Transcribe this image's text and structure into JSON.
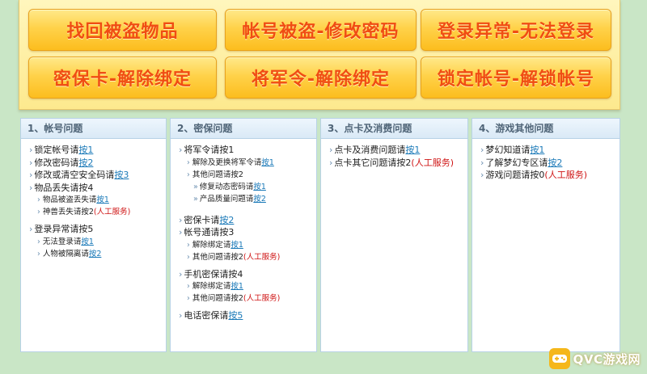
{
  "top_buttons": [
    {
      "label": "找回被盗物品"
    },
    {
      "label": "帐号被盗-修改密码"
    },
    {
      "label": "登录异常-无法登录"
    },
    {
      "label": "密保卡-解除绑定"
    },
    {
      "label": "将军令-解除绑定"
    },
    {
      "label": "锁定帐号-解锁帐号"
    }
  ],
  "panel1": {
    "title": "1、帐号问题",
    "items": [
      {
        "text": "锁定帐号请",
        "link": "按1"
      },
      {
        "text": "修改密码请",
        "link": "按2"
      },
      {
        "text": "修改或清空安全码请",
        "link": "按3"
      },
      {
        "text": "物品丢失请按4"
      },
      {
        "text": "物品被盗丢失请",
        "link": "按1"
      },
      {
        "text": "神兽丢失请按2",
        "tag": "(人工服务)"
      },
      {
        "text": "登录异常请按5"
      },
      {
        "text": "无法登录请",
        "link": "按1"
      },
      {
        "text": "人物被隔离请",
        "link": "按2"
      }
    ]
  },
  "panel2": {
    "title": "2、密保问题",
    "items": [
      {
        "text": "将军令请按1"
      },
      {
        "text": "解除及更换将军令请",
        "link": "按1"
      },
      {
        "text": "其他问题请按2"
      },
      {
        "text": "修复动态密码请",
        "link": "按1"
      },
      {
        "text": "产品质量问题请",
        "link": "按2"
      },
      {
        "text": "密保卡请",
        "link": "按2"
      },
      {
        "text": "帐号通请按3"
      },
      {
        "text": "解除绑定请",
        "link": "按1"
      },
      {
        "text": "其他问题请按2",
        "tag": "(人工服务)"
      },
      {
        "text": "手机密保请按4"
      },
      {
        "text": "解除绑定请",
        "link": "按1"
      },
      {
        "text": "其他问题请按2",
        "tag": "(人工服务)"
      },
      {
        "text": "电话密保请",
        "link": "按5"
      }
    ]
  },
  "panel3": {
    "title": "3、点卡及消费问题",
    "items": [
      {
        "text": "点卡及消费问题请",
        "link": "按1"
      },
      {
        "text": "点卡其它问题请按2",
        "tag": "(人工服务)"
      }
    ]
  },
  "panel4": {
    "title": "4、游戏其他问题",
    "items": [
      {
        "text": "梦幻知道请",
        "link": "按1"
      },
      {
        "text": "了解梦幻专区请",
        "link": "按2"
      },
      {
        "text": "游戏问题请按0",
        "tag": "(人工服务)"
      }
    ]
  },
  "watermark": {
    "text": "QVC游戏网",
    "icon": "gamepad-icon"
  },
  "colors": {
    "accent_orange": "#f04d13",
    "link_blue": "#1a79b8",
    "service_red": "#cf1414",
    "background": "#c9e6c6"
  }
}
